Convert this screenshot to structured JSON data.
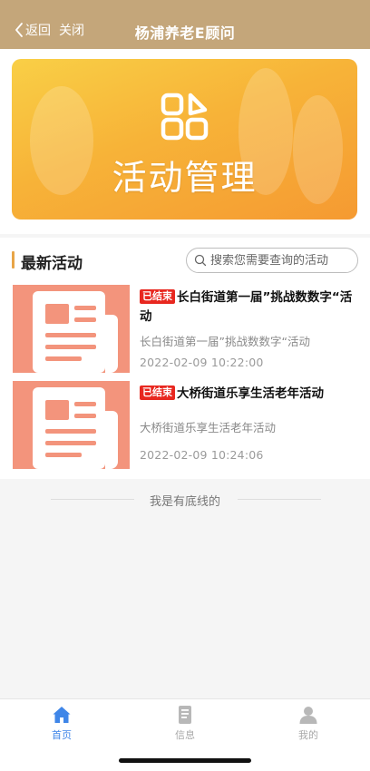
{
  "header": {
    "back_label": "返回",
    "close_label": "关闭",
    "title": "杨浦养老E顾问"
  },
  "banner": {
    "title": "活动管理"
  },
  "section": {
    "title": "最新活动",
    "search_placeholder": "搜索您需要查询的活动"
  },
  "activities": [
    {
      "badge": "已结束",
      "title": "长白街道第一届”挑战数数字“活动",
      "desc": "长白街道第一届”挑战数数字“活动",
      "time": "2022-02-09 10:22:00"
    },
    {
      "badge": "已结束",
      "title": "大桥街道乐享生活老年活动",
      "desc": "大桥街道乐享生活老年活动",
      "time": "2022-02-09 10:24:06"
    }
  ],
  "end_text": "我是有底线的",
  "tabs": [
    {
      "label": "首页",
      "icon": "home-icon",
      "active": true
    },
    {
      "label": "信息",
      "icon": "document-icon",
      "active": false
    },
    {
      "label": "我的",
      "icon": "user-icon",
      "active": false
    }
  ],
  "colors": {
    "header": "#c4a67a",
    "accent": "#e8a547",
    "badge": "#e8271f",
    "tab_active": "#3f86e8",
    "thumb": "#f3947c"
  }
}
